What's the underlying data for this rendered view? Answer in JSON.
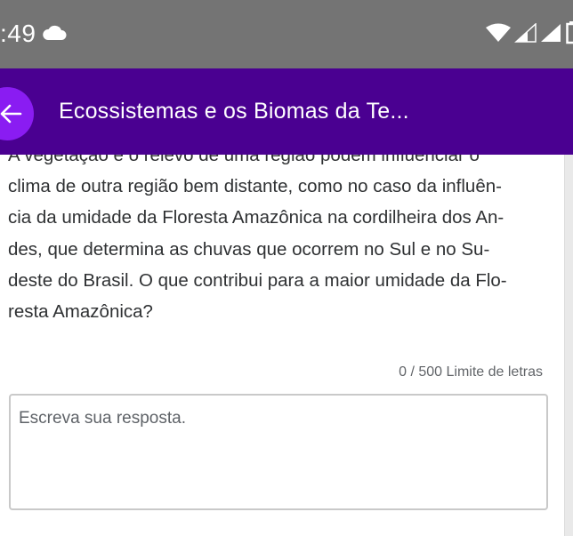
{
  "status_bar": {
    "time": ":49",
    "icons": [
      "cloud-icon",
      "wifi-icon",
      "signal-icon",
      "signal-icon",
      "battery-icon"
    ]
  },
  "app_bar": {
    "back_icon": "arrow-left-icon",
    "title": "Ecossistemas e os Biomas da Te...",
    "background_color": "#4a0091",
    "back_button_color": "#8a1cf2"
  },
  "question": {
    "lines": [
      "A vegetação e o relevo de uma região podem influenciar o",
      "clima de outra região bem distante, como no caso da influên-",
      "cia da umidade da Floresta Amazônica na cordilheira dos An-",
      "des, que determina as chuvas que ocorrem no Sul e no Su-",
      "deste do Brasil. O que contribui para a maior umidade da Flo-",
      "resta Amazônica?"
    ]
  },
  "answer": {
    "count": "0",
    "separator": " / ",
    "limit_label": "500 Limite de letras",
    "placeholder": "Escreva sua resposta.",
    "value": ""
  }
}
